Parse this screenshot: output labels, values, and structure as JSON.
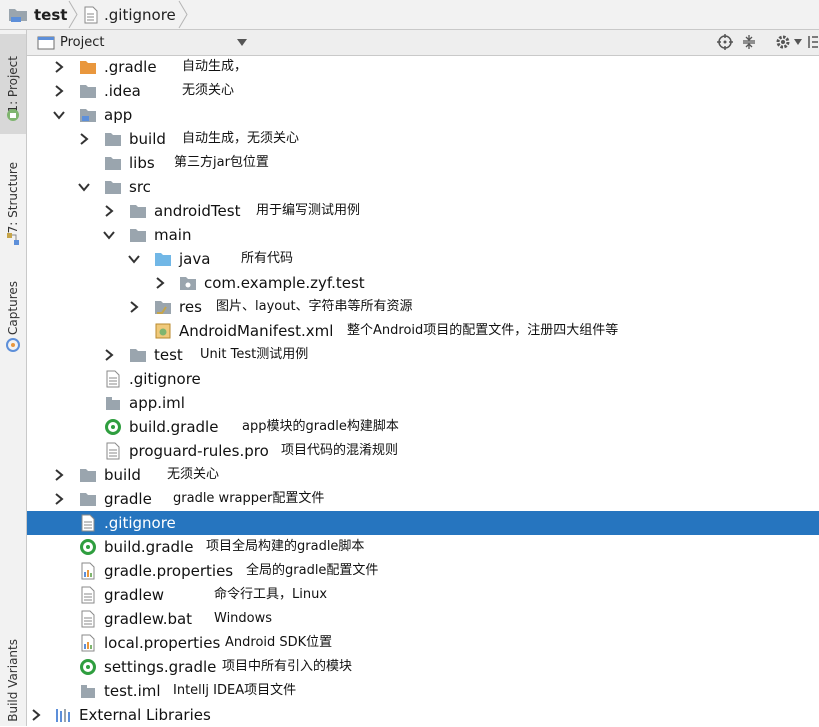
{
  "breadcrumb": {
    "project": "test",
    "file": ".gitignore"
  },
  "sidebar": {
    "tabs": [
      "1: Project",
      "7: Structure",
      "Captures",
      "Build Variants"
    ]
  },
  "panel": {
    "view_mode": "Project"
  },
  "colors": {
    "selection": "#2675bf",
    "folder_gray": "#9aa5ae",
    "folder_orange": "#e9973d",
    "folder_blue": "#71b7e6",
    "gradle_green": "#2f9e3f"
  },
  "tree": [
    {
      "name": ".gradle",
      "note": "自动生成，",
      "icon": "folder-orange-icon",
      "arrow": "right"
    },
    {
      "name": ".idea",
      "note": "无须关心",
      "icon": "folder-icon",
      "arrow": "right"
    },
    {
      "name": "app",
      "note": "",
      "icon": "folder-module-icon",
      "arrow": "down"
    },
    {
      "name": "build",
      "note": "自动生成，无须关心",
      "icon": "folder-icon",
      "arrow": "right"
    },
    {
      "name": "libs",
      "note": "第三方jar包位置",
      "icon": "folder-icon",
      "arrow": "none"
    },
    {
      "name": "src",
      "note": "",
      "icon": "folder-icon",
      "arrow": "down"
    },
    {
      "name": "androidTest",
      "note": "用于编写测试用例",
      "icon": "folder-icon",
      "arrow": "right"
    },
    {
      "name": "main",
      "note": "",
      "icon": "folder-icon",
      "arrow": "down"
    },
    {
      "name": "java",
      "note": "所有代码",
      "icon": "folder-source-icon",
      "arrow": "down"
    },
    {
      "name": "com.example.zyf.test",
      "note": "",
      "icon": "package-icon",
      "arrow": "right"
    },
    {
      "name": "res",
      "note": "图片、layout、字符串等所有资源",
      "icon": "folder-resource-icon",
      "arrow": "right"
    },
    {
      "name": "AndroidManifest.xml",
      "note": "整个Android项目的配置文件，注册四大组件等",
      "icon": "manifest-icon",
      "arrow": "none"
    },
    {
      "name": "test",
      "note": "Unit Test测试用例",
      "icon": "folder-icon",
      "arrow": "right"
    },
    {
      "name": ".gitignore",
      "note": "",
      "icon": "file-text-icon",
      "arrow": "none"
    },
    {
      "name": "app.iml",
      "note": "",
      "icon": "module-file-icon",
      "arrow": "none"
    },
    {
      "name": "build.gradle",
      "note": "app模块的gradle构建脚本",
      "icon": "gradle-icon",
      "arrow": "none"
    },
    {
      "name": "proguard-rules.pro",
      "note": "项目代码的混淆规则",
      "icon": "file-text-icon",
      "arrow": "none"
    },
    {
      "name": "build",
      "note": "无须关心",
      "icon": "folder-icon",
      "arrow": "right"
    },
    {
      "name": "gradle",
      "note": "gradle wrapper配置文件",
      "icon": "folder-icon",
      "arrow": "right"
    },
    {
      "name": ".gitignore",
      "note": "",
      "icon": "file-text-icon",
      "arrow": "none",
      "selected": true
    },
    {
      "name": "build.gradle",
      "note": "项目全局构建的gradle脚本",
      "icon": "gradle-icon",
      "arrow": "none"
    },
    {
      "name": "gradle.properties",
      "note": "全局的gradle配置文件",
      "icon": "properties-icon",
      "arrow": "none"
    },
    {
      "name": "gradlew",
      "note": "命令行工具，Linux",
      "icon": "file-text-icon",
      "arrow": "none"
    },
    {
      "name": "gradlew.bat",
      "note": "Windows",
      "icon": "file-text-icon",
      "arrow": "none"
    },
    {
      "name": "local.properties",
      "note": "Android SDK位置",
      "icon": "properties-icon",
      "arrow": "none"
    },
    {
      "name": "settings.gradle",
      "note": "项目中所有引入的模块",
      "icon": "gradle-icon",
      "arrow": "none"
    },
    {
      "name": "test.iml",
      "note": "Intellj IDEA项目文件",
      "icon": "module-file-icon",
      "arrow": "none"
    },
    {
      "name": "External Libraries",
      "note": "",
      "icon": "libraries-icon",
      "arrow": "right"
    }
  ]
}
